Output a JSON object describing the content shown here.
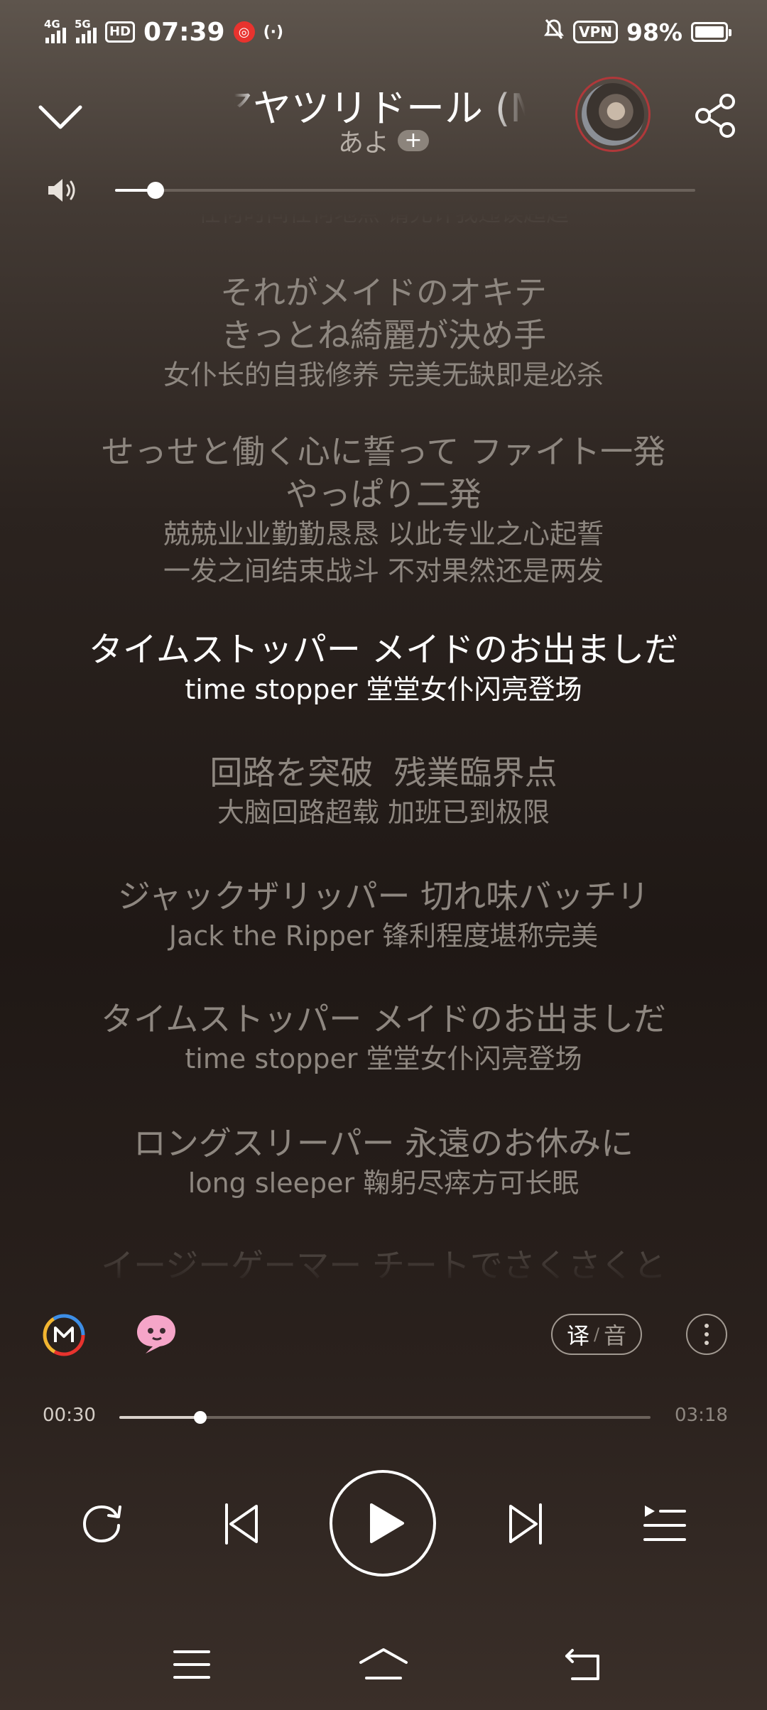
{
  "status_bar": {
    "network1": "4G",
    "network2": "5G",
    "hd": "HD",
    "time": "07:39",
    "vpn": "VPN",
    "battery": "98%"
  },
  "header": {
    "title": "アヤツリドール (M",
    "artist": "あよ",
    "follow": "+"
  },
  "volume": {
    "level": 0.07
  },
  "lyrics": [
    {
      "jp": "任何时间任何地点 请允许我违误超趋",
      "cn": "",
      "cut": true
    },
    {
      "jp": "それがメイドのオキテ",
      "jp2": "きっとね綺麗が決め手",
      "cn": "女仆长的自我修养 完美无缺即是必杀"
    },
    {
      "jp": "せっせと働く心に誓って ファイト一発",
      "jp2": "やっぱり二発",
      "cn": "兢兢业业勤勤恳恳 以此专业之心起誓",
      "cn2": "一发之间结束战斗 不对果然还是两发"
    },
    {
      "jp": "タイムストッパー メイドのお出ましだ",
      "cn": "time stopper 堂堂女仆闪亮登场",
      "active": true
    },
    {
      "jp": "回路を突破  残業臨界点",
      "cn": "大脑回路超载 加班已到极限"
    },
    {
      "jp": "ジャックザリッパー 切れ味バッチリ",
      "cn": "Jack the Ripper 锋利程度堪称完美"
    },
    {
      "jp": "タイムストッパー メイドのお出ましだ",
      "cn": "time stopper 堂堂女仆闪亮登场"
    },
    {
      "jp": "ロングスリーパー 永遠のお休みに",
      "cn": "long sleeper 鞠躬尽瘁方可长眠"
    },
    {
      "jp": "イージーゲーマー チートでさくさくと",
      "cn": ""
    }
  ],
  "tools": {
    "translate": "译",
    "separator": "/",
    "phonetic": "音"
  },
  "progress": {
    "current": "00:30",
    "total": "03:18",
    "fraction": 0.152
  },
  "colors": {
    "accent_red": "#e8332e",
    "lyric_active": "#ffffff",
    "lyric_dim": "#8e8780"
  }
}
